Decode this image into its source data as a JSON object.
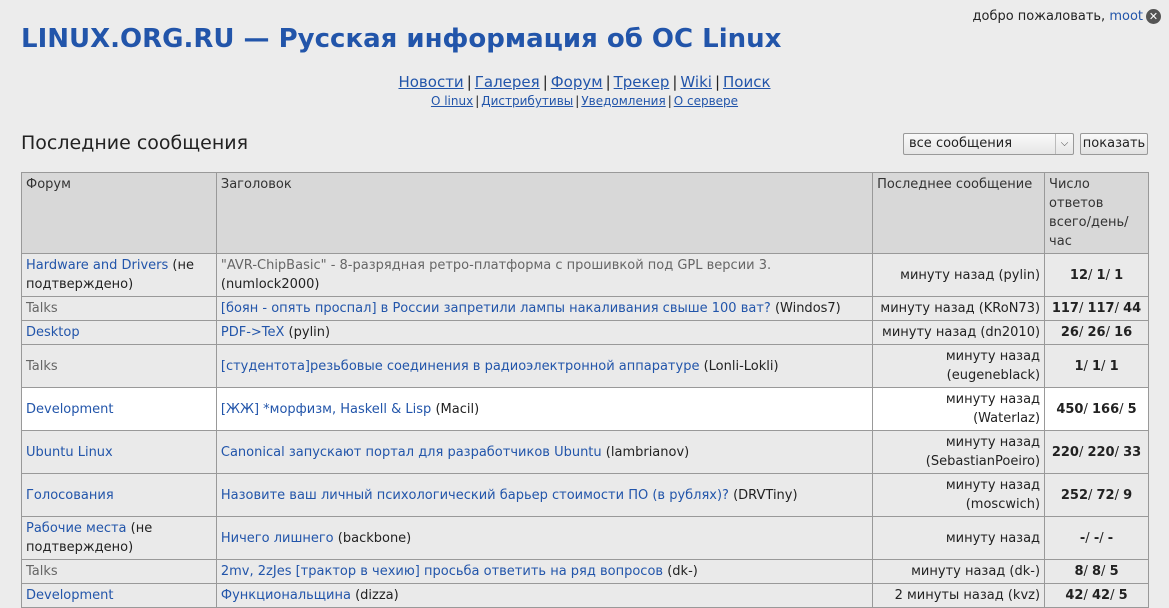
{
  "header": {
    "welcome_text": "добро пожаловать,",
    "username": "moot",
    "site_title": "LINUX.ORG.RU — Русская информация об ОС Linux"
  },
  "nav_main": [
    "Новости",
    "Галерея",
    "Форум",
    "Трекер",
    "Wiki",
    "Поиск"
  ],
  "nav_sub": [
    "О linux",
    "Дистрибутивы",
    "Уведомления",
    "О сервере"
  ],
  "section": {
    "title": "Последние сообщения",
    "filter_value": "все сообщения",
    "show_label": "показать"
  },
  "table": {
    "headers": [
      "Форум",
      "Заголовок",
      "Последнее сообщение",
      "Число ответов всего/день/час"
    ],
    "rows": [
      {
        "forum": "Hardware and Drivers",
        "forum_note": " (не подтверждено)",
        "forum_link": true,
        "title": "\"AVR-ChipBasic\" - 8-разрядная ретро-платформа с прошивкой под GPL версии 3.",
        "title_gray": true,
        "author": " (numlock2000)",
        "last": "минуту назад (pylin)",
        "c1": "12",
        "c2": "1",
        "c3": "1"
      },
      {
        "forum": "Talks",
        "forum_note": "",
        "forum_link": false,
        "title": "[боян - опять проспал] в России запретили лампы накаливания свыше 100 ват?",
        "title_gray": false,
        "author": " (Windos7)",
        "last": "минуту назад (KRoN73)",
        "c1": "117",
        "c2": "117",
        "c3": "44"
      },
      {
        "forum": "Desktop",
        "forum_note": "",
        "forum_link": true,
        "title": "PDF->TeX",
        "title_gray": false,
        "author": " (pylin)",
        "last": "минуту назад (dn2010)",
        "c1": "26",
        "c2": "26",
        "c3": "16"
      },
      {
        "forum": "Talks",
        "forum_note": "",
        "forum_link": false,
        "title": "[студентота]резьбовые соединения в радиоэлектронной аппаратуре",
        "title_gray": false,
        "author": " (Lonli-Lokli)",
        "last": "минуту назад (eugeneblack)",
        "c1": "1",
        "c2": "1",
        "c3": "1"
      },
      {
        "forum": "Development",
        "forum_note": "",
        "forum_link": true,
        "title": "[ЖЖ] *морфизм, Haskell & Lisp",
        "title_gray": false,
        "author": " (Macil)",
        "last": "минуту назад (Waterlaz)",
        "c1": "450",
        "c2": "166",
        "c3": "5"
      },
      {
        "forum": "Ubuntu Linux",
        "forum_note": "",
        "forum_link": true,
        "title": "Canonical запускают портал для разработчиков Ubuntu",
        "title_gray": false,
        "author": " (lambrianov)",
        "last": "минуту назад (SebastianPoeiro)",
        "c1": "220",
        "c2": "220",
        "c3": "33"
      },
      {
        "forum": "Голосования",
        "forum_note": "",
        "forum_link": true,
        "title": "Назовите ваш личный психологический барьер стоимости ПО (в рублях)?",
        "title_gray": false,
        "author": " (DRVTiny)",
        "last": "минуту назад (moscwich)",
        "c1": "252",
        "c2": "72",
        "c3": "9"
      },
      {
        "forum": "Рабочие места",
        "forum_note": " (не подтверждено)",
        "forum_link": true,
        "title": "Ничего лишнего",
        "title_gray": false,
        "author": " (backbone)",
        "last": "минуту назад",
        "c1": "-",
        "c2": "-",
        "c3": "-"
      },
      {
        "forum": "Talks",
        "forum_note": "",
        "forum_link": false,
        "title": "2mv, 2zJes [трактор в чехию] просьба ответить на ряд вопросов",
        "title_gray": false,
        "author": " (dk-)",
        "last": "минуту назад (dk-)",
        "c1": "8",
        "c2": "8",
        "c3": "5"
      },
      {
        "forum": "Development",
        "forum_note": "",
        "forum_link": true,
        "title": "Функциональщина",
        "title_gray": false,
        "author": " (dizza)",
        "last": "2 минуты назад (kvz)",
        "c1": "42",
        "c2": "42",
        "c3": "5"
      }
    ]
  }
}
